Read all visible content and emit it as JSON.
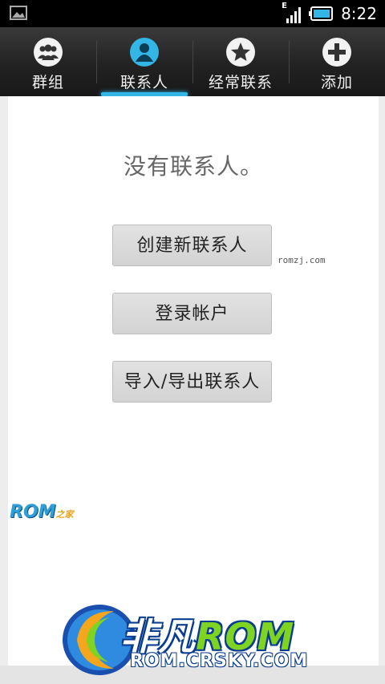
{
  "status_bar": {
    "network_type": "E",
    "time": "8:22"
  },
  "tabs": [
    {
      "label": "群组",
      "icon": "groups-icon",
      "selected": false
    },
    {
      "label": "联系人",
      "icon": "person-icon",
      "selected": true
    },
    {
      "label": "经常联系",
      "icon": "star-icon",
      "selected": false
    },
    {
      "label": "添加",
      "icon": "plus-icon",
      "selected": false
    }
  ],
  "main": {
    "empty_message": "没有联系人。",
    "buttons": {
      "create": "创建新联系人",
      "login": "登录帐户",
      "import_export": "导入/导出联系人"
    }
  },
  "watermarks": {
    "small_site": "romzj.com",
    "romzj_logo": "ROM",
    "romzj_suffix": "之家",
    "brand_cn": "非凡",
    "brand_rom": "ROM",
    "brand_url": "ROM.CRSKY.COM"
  },
  "colors": {
    "accent": "#33b5e5",
    "tabbar": "#222222",
    "background": "#ededed"
  }
}
